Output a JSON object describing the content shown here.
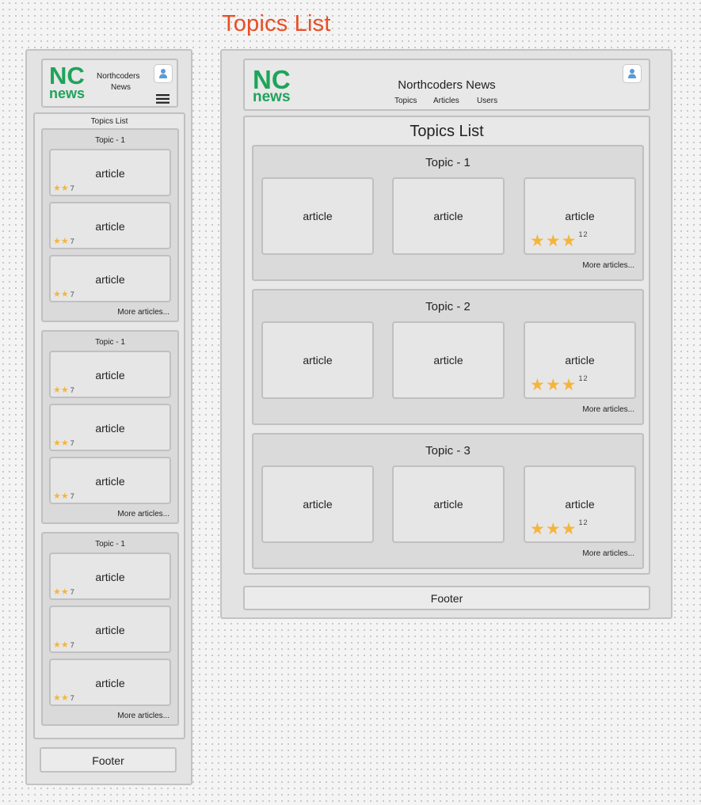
{
  "page": {
    "title": "Topics List"
  },
  "brand": {
    "nc": "NC",
    "news": "news",
    "name_line1": "Northcoders",
    "name_line2": "News",
    "name_full": "Northcoders News"
  },
  "nav": [
    "Topics",
    "Articles",
    "Users"
  ],
  "section_title": "Topics List",
  "footer": "Footer",
  "more_label": "More articles...",
  "mobile": {
    "topics": [
      {
        "title": "Topic - 1",
        "articles": [
          {
            "label": "article",
            "stars": 2,
            "rating": "7"
          },
          {
            "label": "article",
            "stars": 2,
            "rating": "7"
          },
          {
            "label": "article",
            "stars": 2,
            "rating": "7"
          }
        ]
      },
      {
        "title": "Topic - 1",
        "articles": [
          {
            "label": "article",
            "stars": 2,
            "rating": "7"
          },
          {
            "label": "article",
            "stars": 2,
            "rating": "7"
          },
          {
            "label": "article",
            "stars": 2,
            "rating": "7"
          }
        ]
      },
      {
        "title": "Topic - 1",
        "articles": [
          {
            "label": "article",
            "stars": 2,
            "rating": "7"
          },
          {
            "label": "article",
            "stars": 2,
            "rating": "7"
          },
          {
            "label": "article",
            "stars": 2,
            "rating": "7"
          }
        ]
      }
    ]
  },
  "desktop": {
    "topics": [
      {
        "title": "Topic - 1",
        "articles": [
          {
            "label": "article"
          },
          {
            "label": "article"
          },
          {
            "label": "article",
            "stars": 3,
            "rating": "12"
          }
        ]
      },
      {
        "title": "Topic - 2",
        "articles": [
          {
            "label": "article"
          },
          {
            "label": "article"
          },
          {
            "label": "article",
            "stars": 3,
            "rating": "12"
          }
        ]
      },
      {
        "title": "Topic - 3",
        "articles": [
          {
            "label": "article"
          },
          {
            "label": "article"
          },
          {
            "label": "article",
            "stars": 3,
            "rating": "12"
          }
        ]
      }
    ]
  },
  "colors": {
    "title_accent": "#e94e24",
    "logo_green": "#1fa45a",
    "star_gold": "#f5b53d",
    "avatar_blue": "#5b9bd5"
  },
  "icons": {
    "avatar": "user-avatar-icon",
    "menu": "hamburger-menu-icon",
    "star": "star-icon"
  }
}
